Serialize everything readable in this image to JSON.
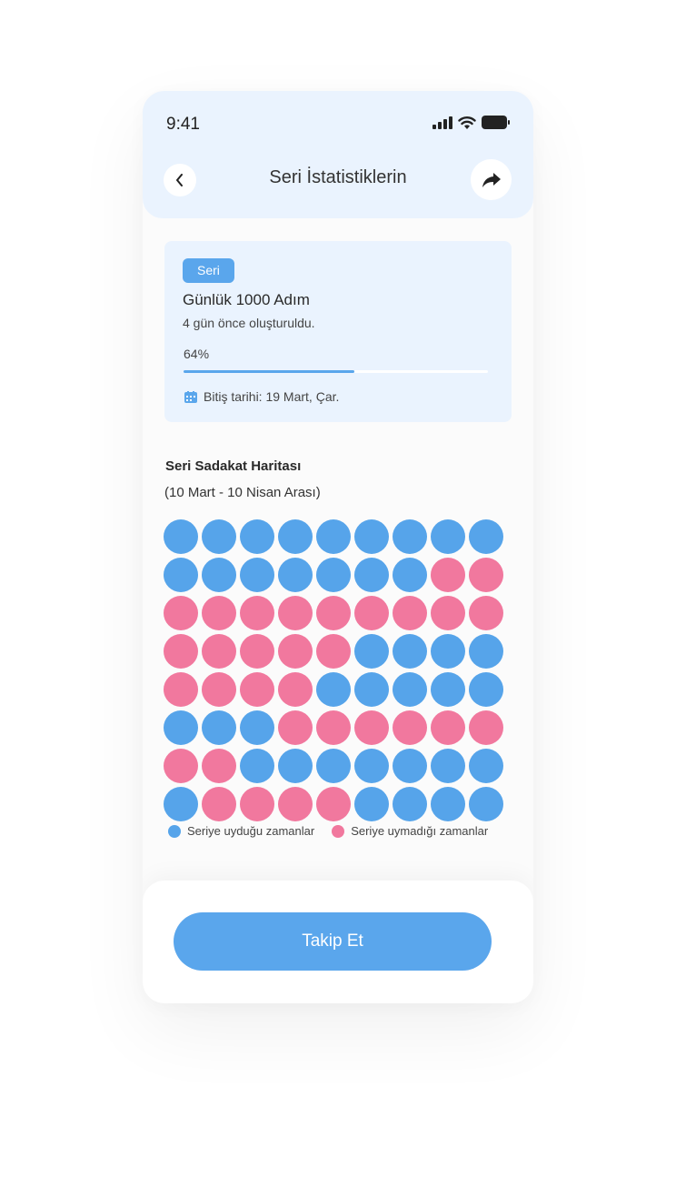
{
  "status_bar": {
    "time": "9:41"
  },
  "header": {
    "title": "Seri İstatistiklerin"
  },
  "card": {
    "badge": "Seri",
    "habit_name": "Günlük 1000 Adım",
    "created": "4 gün önce oluşturuldu.",
    "progress_label": "64%",
    "progress": 0.56,
    "end_date": "Bitiş tarihi: 19 Mart, Çar."
  },
  "map": {
    "title": "Seri Sadakat Haritası",
    "range": "(10 Mart - 10 Nisan Arası)",
    "colors": {
      "followed": "#56a4ea",
      "missed": "#f1789e"
    },
    "rows": [
      [
        "followed",
        "followed",
        "followed",
        "followed",
        "followed",
        "followed",
        "followed",
        "followed",
        "followed"
      ],
      [
        "followed",
        "followed",
        "followed",
        "followed",
        "followed",
        "followed",
        "followed",
        "missed",
        "missed"
      ],
      [
        "missed",
        "missed",
        "missed",
        "missed",
        "missed",
        "missed",
        "missed",
        "missed",
        "missed"
      ],
      [
        "missed",
        "missed",
        "missed",
        "missed",
        "missed",
        "followed",
        "followed",
        "followed",
        "followed"
      ],
      [
        "missed",
        "missed",
        "missed",
        "missed",
        "followed",
        "followed",
        "followed",
        "followed",
        "followed"
      ],
      [
        "followed",
        "followed",
        "followed",
        "missed",
        "missed",
        "missed",
        "missed",
        "missed",
        "missed"
      ],
      [
        "missed",
        "missed",
        "followed",
        "followed",
        "followed",
        "followed",
        "followed",
        "followed",
        "followed"
      ],
      [
        "followed",
        "missed",
        "missed",
        "missed",
        "missed",
        "followed",
        "followed",
        "followed",
        "followed"
      ]
    ],
    "legend": {
      "followed": "Seriye uyduğu zamanlar",
      "missed": "Seriye uymadığı zamanlar"
    }
  },
  "footer": {
    "button_label": "Takip Et"
  }
}
